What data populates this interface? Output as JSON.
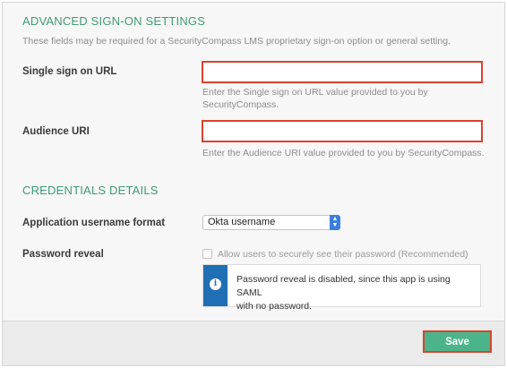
{
  "advanced": {
    "title": "ADVANCED SIGN-ON SETTINGS",
    "description": "These fields may be required for a SecurityCompass LMS proprietary sign-on option or general setting.",
    "sso_url": {
      "label": "Single sign on URL",
      "value": "",
      "help_line1": "Enter the Single sign on URL value provided to you by",
      "help_line2": "SecurityCompass."
    },
    "audience_uri": {
      "label": "Audience URI",
      "value": "",
      "help": "Enter the Audience URI value provided to you by SecurityCompass."
    }
  },
  "credentials": {
    "title": "CREDENTIALS DETAILS",
    "username_format": {
      "label": "Application username format",
      "selected": "Okta username"
    },
    "password_reveal": {
      "label": "Password reveal",
      "checkbox_label": "Allow users to securely see their password (Recommended)",
      "checked": false,
      "info_line1": "Password reveal is disabled, since this app is using SAML",
      "info_line2": "with no password."
    }
  },
  "footer": {
    "save_label": "Save"
  },
  "colors": {
    "accent_green": "#3e9b74",
    "button_green": "#4cb48a",
    "highlight_red": "#d9432d",
    "info_blue": "#1f6fb5"
  },
  "icons": {
    "select_arrows": "chevron-up-down-icon",
    "info": "info-icon"
  }
}
